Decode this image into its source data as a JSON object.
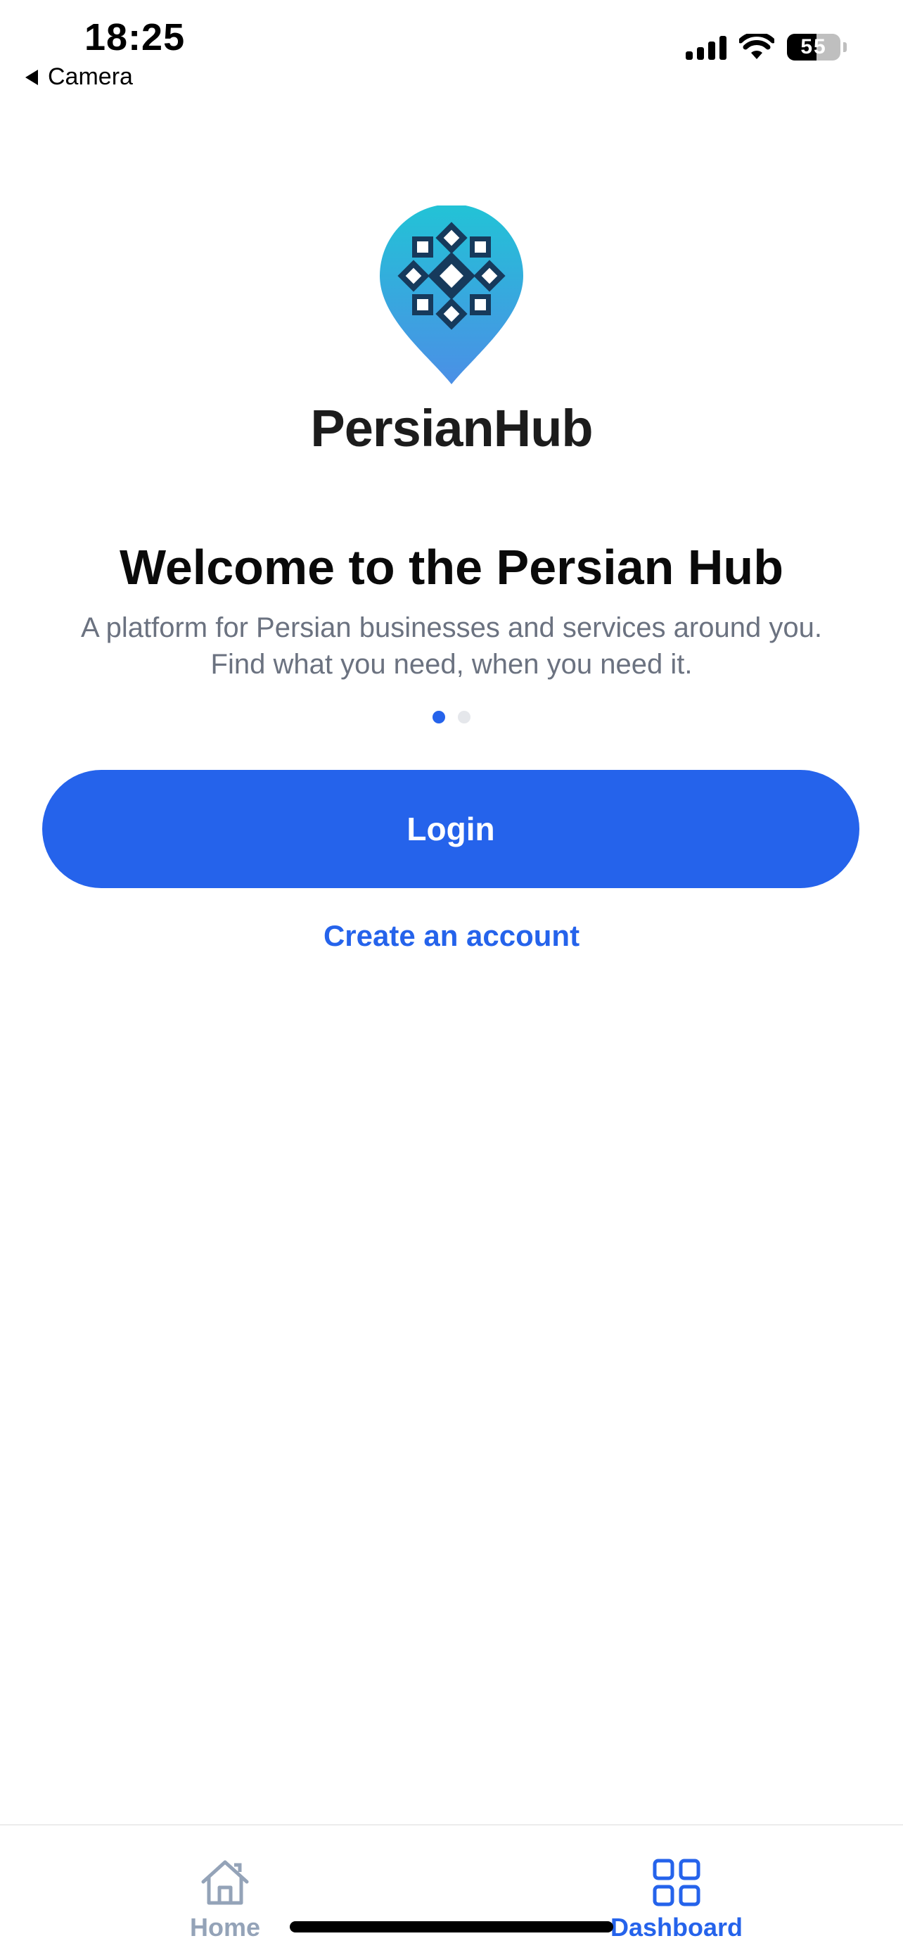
{
  "status_bar": {
    "time": "18:25",
    "back_label": "Camera",
    "battery_level": "55",
    "icons": [
      "cellular-signal-icon",
      "wifi-icon",
      "battery-icon"
    ]
  },
  "brand": {
    "name": "PersianHub",
    "logo_colors": {
      "top": "#22c3d6",
      "bottom": "#4b8fe6",
      "motif": "#163a5c"
    }
  },
  "welcome": {
    "title": "Welcome to the Persian Hub",
    "subtitle_line1": "A platform for Persian businesses and services around you.",
    "subtitle_line2": "Find what you need, when you need it."
  },
  "pager": {
    "total": 2,
    "active_index": 0
  },
  "actions": {
    "login_label": "Login",
    "create_account_label": "Create an account"
  },
  "tabs": [
    {
      "label": "Home",
      "icon": "home-icon",
      "active": false
    },
    {
      "label": "Dashboard",
      "icon": "grid-icon",
      "active": true
    }
  ],
  "colors": {
    "accent": "#2563eb",
    "muted_text": "#6b7280",
    "inactive_tab": "#94a3b8"
  }
}
